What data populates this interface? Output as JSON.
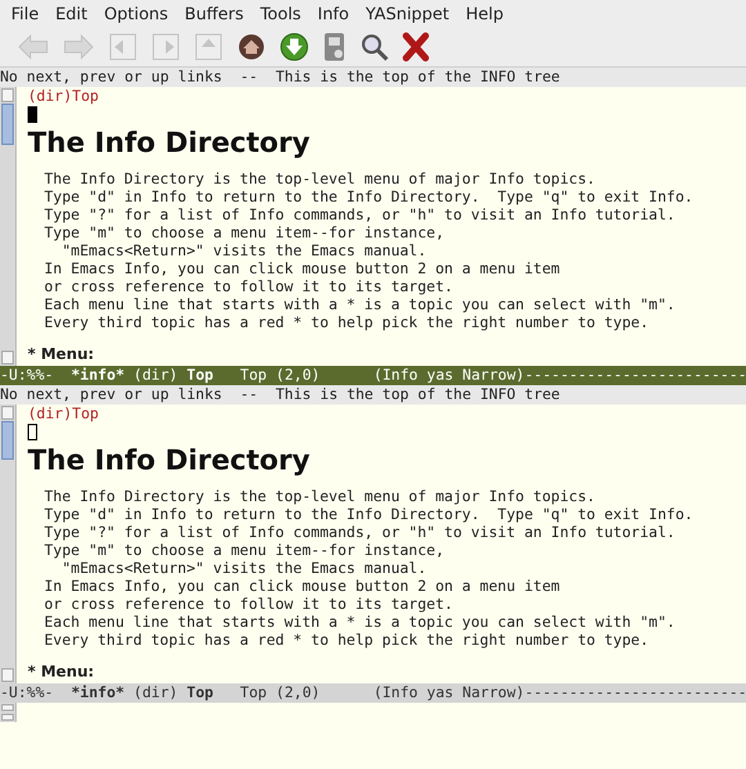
{
  "menu": [
    "File",
    "Edit",
    "Options",
    "Buffers",
    "Tools",
    "Info",
    "YASnippet",
    "Help"
  ],
  "toolbar": [
    {
      "kind": "back",
      "disabled": true
    },
    {
      "kind": "forward",
      "disabled": true
    },
    {
      "kind": "prev",
      "disabled": true
    },
    {
      "kind": "next",
      "disabled": true
    },
    {
      "kind": "up",
      "disabled": true
    },
    {
      "kind": "home",
      "disabled": false
    },
    {
      "kind": "goto",
      "disabled": false
    },
    {
      "kind": "index",
      "disabled": false
    },
    {
      "kind": "search",
      "disabled": false
    },
    {
      "kind": "exit",
      "disabled": false
    }
  ],
  "windows": [
    {
      "active": true,
      "header": "No next, prev or up links  --  This is the top of the INFO tree",
      "node_link": "(dir)Top",
      "heading": "The Info Directory",
      "lines": [
        "The Info Directory is the top-level menu of major Info topics.",
        "Type \"d\" in Info to return to the Info Directory.  Type \"q\" to exit Info.",
        "Type \"?\" for a list of Info commands, or \"h\" to visit an Info tutorial.",
        "Type \"m\" to choose a menu item--for instance,",
        "  \"mEmacs<Return>\" visits the Emacs manual.",
        "In Emacs Info, you can click mouse button 2 on a menu item",
        "or cross reference to follow it to its target.",
        "Each menu line that starts with a * is a topic you can select with \"m\".",
        "Every third topic has a red * to help pick the right number to type."
      ],
      "menu_label": "* Menu:",
      "mode_line": {
        "status": "-U:%%-",
        "buffer": "*info*",
        "file": "(dir)",
        "node": "Top",
        "position": "Top (2,0)",
        "modes": "(Info yas Narrow)",
        "fill": "-------------------------"
      }
    },
    {
      "active": false,
      "header": "No next, prev or up links  --  This is the top of the INFO tree",
      "node_link": "(dir)Top",
      "heading": "The Info Directory",
      "lines": [
        "The Info Directory is the top-level menu of major Info topics.",
        "Type \"d\" in Info to return to the Info Directory.  Type \"q\" to exit Info.",
        "Type \"?\" for a list of Info commands, or \"h\" to visit an Info tutorial.",
        "Type \"m\" to choose a menu item--for instance,",
        "  \"mEmacs<Return>\" visits the Emacs manual.",
        "In Emacs Info, you can click mouse button 2 on a menu item",
        "or cross reference to follow it to its target.",
        "Each menu line that starts with a * is a topic you can select with \"m\".",
        "Every third topic has a red * to help pick the right number to type."
      ],
      "menu_label": "* Menu:",
      "mode_line": {
        "status": "-U:%%-",
        "buffer": "*info*",
        "file": "(dir)",
        "node": "Top",
        "position": "Top (2,0)",
        "modes": "(Info yas Narrow)",
        "fill": "-------------------------"
      }
    }
  ]
}
